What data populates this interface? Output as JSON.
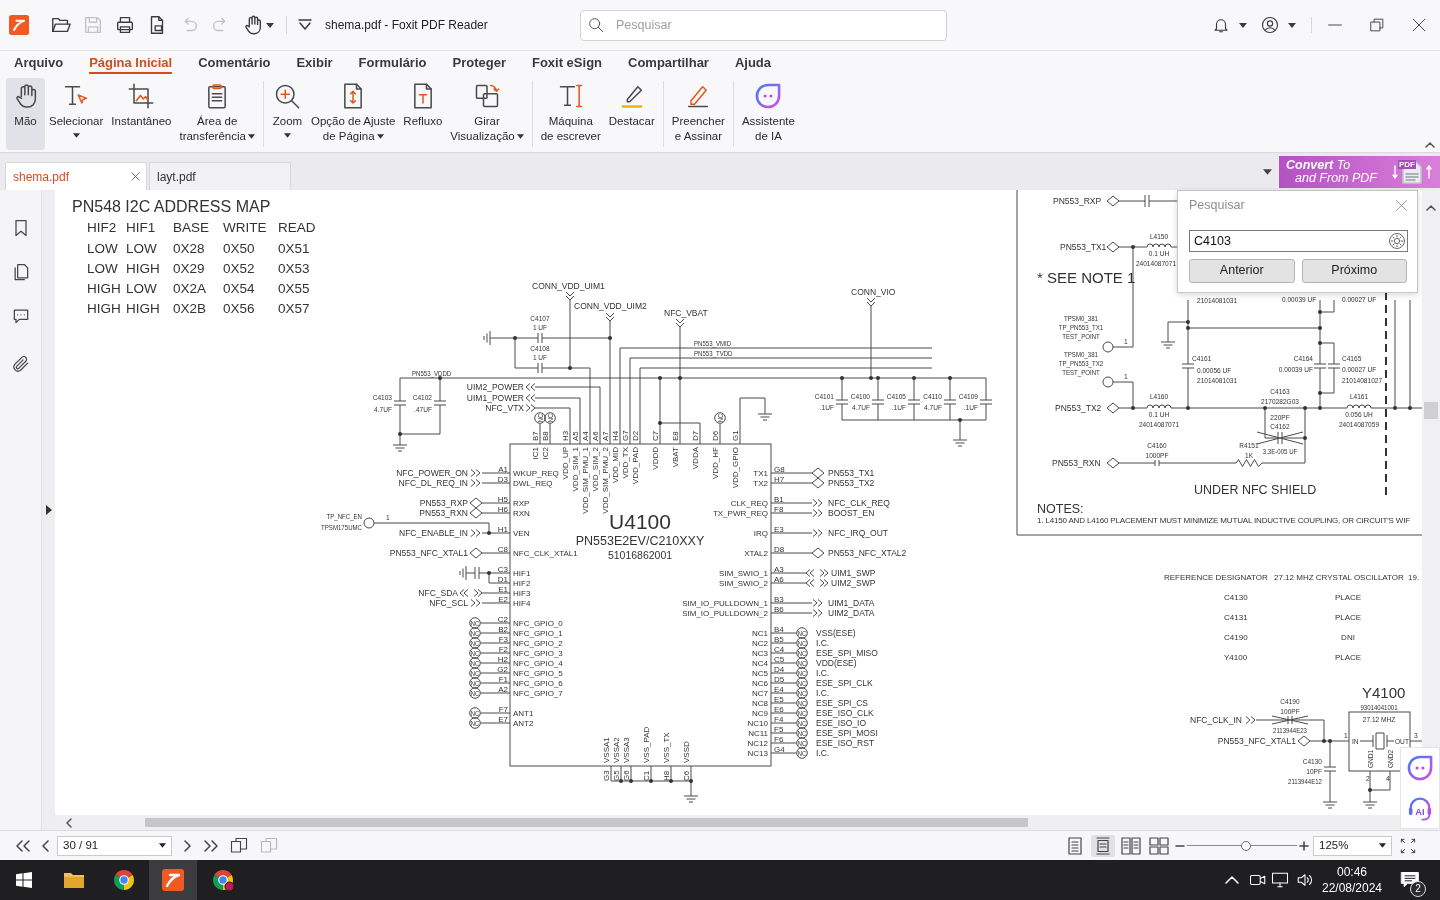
{
  "window": {
    "title": "shema.pdf - Foxit PDF Reader"
  },
  "quick_access": [
    {
      "disabled": false
    },
    {
      "disabled": true
    },
    {
      "disabled": false
    },
    {
      "disabled": false
    },
    {
      "disabled": true
    },
    {
      "disabled": true
    },
    {
      "disabled": false
    }
  ],
  "search": {
    "placeholder": "Pesquisar"
  },
  "menu": [
    {
      "label": "Arquivo",
      "selected": false
    },
    {
      "label": "Página Inicial",
      "selected": true
    },
    {
      "label": "Comentário",
      "selected": false
    },
    {
      "label": "Exibir",
      "selected": false
    },
    {
      "label": "Formulário",
      "selected": false
    },
    {
      "label": "Proteger",
      "selected": false
    },
    {
      "label": "Foxit eSign",
      "selected": false
    },
    {
      "label": "Compartilhar",
      "selected": false
    },
    {
      "label": "Ajuda",
      "selected": false
    }
  ],
  "ribbon": [
    [
      {
        "label": "Mão",
        "selected": true,
        "dropdown": false
      },
      {
        "label": "Selecionar",
        "selected": false,
        "dropdown": true
      },
      {
        "label": "Instantâneo",
        "selected": false,
        "dropdown": false
      },
      {
        "label": "Área de\ntransferência",
        "selected": false,
        "dropdown": true
      }
    ],
    [
      {
        "label": "Zoom",
        "selected": false,
        "dropdown": true
      },
      {
        "label": "Opção de Ajuste\nde Página",
        "selected": false,
        "dropdown": true
      },
      {
        "label": "Refluxo",
        "selected": false,
        "dropdown": false
      },
      {
        "label": "Girar\nVisualização",
        "selected": false,
        "dropdown": true
      }
    ],
    [
      {
        "label": "Máquina\nde escrever",
        "selected": false,
        "dropdown": false
      },
      {
        "label": "Destacar",
        "selected": false,
        "dropdown": false
      }
    ],
    [
      {
        "label": "Preencher\ne Assinar",
        "selected": false,
        "dropdown": false
      }
    ],
    [
      {
        "label": "Assistente\nde IA",
        "selected": false,
        "dropdown": false
      }
    ]
  ],
  "doc_tabs": [
    {
      "label": "shema.pdf",
      "selected": true
    },
    {
      "label": "layt.pdf",
      "selected": false
    }
  ],
  "banner": {
    "lines": [
      "**Convert** To",
      "and From PDF"
    ],
    "file_type": "PDF"
  },
  "find_panel": {
    "title": "Pesquisar",
    "query": "C4103",
    "buttons": [
      "Anterior",
      "Próximo"
    ]
  },
  "schematic": {
    "address_map": {
      "title": "PN548 I2C ADDRESS MAP",
      "columns": [
        "HIF2",
        "HIF1",
        "BASE",
        "WRITE",
        "READ"
      ],
      "rows": [
        [
          "LOW",
          "LOW",
          "0X28",
          "0X50",
          "0X51"
        ],
        [
          "LOW",
          "HIGH",
          "0X29",
          "0X52",
          "0X53"
        ],
        [
          "HIGH",
          "LOW",
          "0X2A",
          "0X54",
          "0X55"
        ],
        [
          "HIGH",
          "HIGH",
          "0X2B",
          "0X56",
          "0X57"
        ]
      ]
    },
    "top_labels": [
      {
        "text": "CONN_VDD_UIM1",
        "kind": "net"
      },
      {
        "text": "CONN_VIO",
        "kind": "net"
      },
      {
        "text": "CONN_VDD_UIM2",
        "kind": "net"
      },
      {
        "text": "C4107",
        "kind": "part"
      },
      {
        "text": "NFC_VBAT",
        "kind": "net"
      },
      {
        "text": "1 UF",
        "kind": "part"
      },
      {
        "text": "C4108",
        "kind": "part"
      },
      {
        "text": "PN553_VMID",
        "kind": "code"
      },
      {
        "text": "1 UF",
        "kind": "part"
      },
      {
        "text": "PN553_TVDD",
        "kind": "code"
      },
      {
        "text": "PN553_VDDD",
        "kind": "code"
      },
      {
        "text": "UIM2_POWER",
        "kind": "net"
      },
      {
        "text": "C4103",
        "kind": "part"
      },
      {
        "text": "C4102",
        "kind": "part"
      },
      {
        "text": "UIM1_POWER",
        "kind": "net"
      },
      {
        "text": "C4101",
        "kind": "part"
      },
      {
        "text": "C4100",
        "kind": "part"
      },
      {
        "text": "C4105",
        "kind": "part"
      },
      {
        "text": "C4110",
        "kind": "part"
      },
      {
        "text": "C4109",
        "kind": "part"
      },
      {
        "text": "4.7UF",
        "kind": "part"
      },
      {
        "text": ".47UF",
        "kind": "part"
      },
      {
        "text": "NFC_VTX",
        "kind": "net"
      },
      {
        "text": ".1UF",
        "kind": "part"
      },
      {
        "text": "4.7UF",
        "kind": "part"
      },
      {
        "text": ".1UF",
        "kind": "part"
      },
      {
        "text": "4.7UF",
        "kind": "part"
      },
      {
        "text": ".1UF",
        "kind": "part"
      }
    ],
    "chip": {
      "top": [
        [
          {
            "pin": "B7",
            "name": "IC1",
            "kind": "nc",
            "mark": "NC"
          },
          {
            "pin": "B8",
            "name": "IC2",
            "kind": "nc",
            "mark": "NC"
          }
        ],
        [
          {
            "pin": "H3",
            "name": "VDD_UP",
            "kind": "none"
          },
          {
            "pin": "A5",
            "name": "VDD_SIM_1",
            "kind": "none"
          },
          {
            "pin": "A4",
            "name": "VDD_SIM_PMU_1",
            "kind": "none"
          },
          {
            "pin": "A6",
            "name": "VDD_SIM_2",
            "kind": "none"
          },
          {
            "pin": "A7",
            "name": "VDD_SIM_PMU_2",
            "kind": "none"
          },
          {
            "pin": "H4",
            "name": "VDD_MID",
            "kind": "none"
          },
          {
            "pin": "G7",
            "name": "VDD_TX",
            "kind": "none"
          },
          {
            "pin": "D2",
            "name": "VDD_PAD",
            "kind": "none"
          }
        ],
        [
          {
            "pin": "C7",
            "name": "VDDD",
            "kind": "none"
          }
        ],
        [
          {
            "pin": "E8",
            "name": "VBAT",
            "kind": "none"
          }
        ],
        [
          {
            "pin": "D7",
            "name": "VDDA",
            "kind": "none"
          }
        ],
        [
          {
            "pin": "D6",
            "name": "VDD_HF",
            "kind": "nc",
            "mark": "NC"
          }
        ],
        [
          {
            "pin": "G1",
            "name": "VDD_GPIO",
            "kind": "none"
          }
        ]
      ],
      "ref": "U4100",
      "part": "PN553E2EV/C210XXY",
      "code": "51016862001",
      "left": [
        [
          {
            "pin": "A1",
            "name": "WKUP_REQ",
            "kind": "in",
            "net": "NFC_POWER_ON"
          },
          {
            "pin": "D3",
            "name": "DWL_REQ",
            "kind": "in",
            "net": "NFC_DL_REQ_IN"
          }
        ],
        [
          {
            "pin": "H5",
            "name": "RXP",
            "kind": "port",
            "net": "PN553_RXP"
          },
          {
            "pin": "H6",
            "name": "RXN",
            "kind": "port",
            "net": "PN553_RXN"
          }
        ],
        [
          {
            "pin": "H1",
            "name": "VEN",
            "kind": "in",
            "net": "NFC_ENABLE_IN"
          }
        ],
        [
          {
            "pin": "C8",
            "name": "NFC_CLK_XTAL1",
            "kind": "port",
            "net": "PN553_NFC_XTAL1"
          }
        ],
        [
          {
            "pin": "C3",
            "name": "HIF1",
            "kind": "none"
          },
          {
            "pin": "D1",
            "name": "HIF2",
            "kind": "none"
          },
          {
            "pin": "E1",
            "name": "HIF3",
            "kind": "bidir",
            "net": "NFC_SDA"
          },
          {
            "pin": "E2",
            "name": "HIF4",
            "kind": "in",
            "net": "NFC_SCL"
          }
        ],
        [
          {
            "pin": "C2",
            "name": "NFC_GPIO_0",
            "kind": "nc",
            "mark": "NC"
          },
          {
            "pin": "B2",
            "name": "NFC_GPIO_1",
            "kind": "nc",
            "mark": "NC"
          },
          {
            "pin": "F3",
            "name": "NFC_GPIO_2",
            "kind": "nc",
            "mark": "NC"
          },
          {
            "pin": "F2",
            "name": "NFC_GPIO_3",
            "kind": "nc",
            "mark": "NC"
          },
          {
            "pin": "H2",
            "name": "NFC_GPIO_4",
            "kind": "nc",
            "mark": "NC"
          },
          {
            "pin": "G2",
            "name": "NFC_GPIO_5",
            "kind": "nc",
            "mark": "NC"
          },
          {
            "pin": "F1",
            "name": "NFC_GPIO_6",
            "kind": "nc",
            "mark": "NC"
          },
          {
            "pin": "A2",
            "name": "NFC_GPIO_7",
            "kind": "nc",
            "mark": "NC"
          }
        ],
        [
          {
            "pin": "F7",
            "name": "ANT1",
            "kind": "nc",
            "mark": "NC"
          },
          {
            "pin": "E7",
            "name": "ANT2",
            "kind": "nc",
            "mark": "NC"
          }
        ]
      ],
      "right": [
        [
          {
            "pin": "G8",
            "name": "TX1",
            "kind": "port",
            "net": "PN553_TX1"
          },
          {
            "pin": "H7",
            "name": "TX2",
            "kind": "port",
            "net": "PN553_TX2"
          }
        ],
        [
          {
            "pin": "B1",
            "name": "CLK_REQ",
            "kind": "out",
            "net": "NFC_CLK_REQ"
          },
          {
            "pin": "F8",
            "name": "TX_PWR_REQ",
            "kind": "out",
            "net": "BOOST_EN"
          }
        ],
        [
          {
            "pin": "E3",
            "name": "IRQ",
            "kind": "out",
            "net": "NFC_IRQ_OUT"
          }
        ],
        [
          {
            "pin": "D8",
            "name": "XTAL2",
            "kind": "port",
            "net": "PN553_NFC_XTAL2"
          }
        ],
        [
          {
            "pin": "A3",
            "name": "SIM_SWIO_1",
            "kind": "bidir",
            "net": "UIM1_SWP"
          },
          {
            "pin": "A6",
            "name": "SIM_SWIO_2",
            "kind": "bidir",
            "net": "UIM2_SWP"
          }
        ],
        [
          {
            "pin": "B3",
            "name": "SIM_IO_PULLDOWN_1",
            "kind": "out",
            "net": "UIM1_DATA"
          },
          {
            "pin": "B6",
            "name": "SIM_IO_PULLDOWN_2",
            "kind": "out",
            "net": "UIM2_DATA"
          }
        ],
        [
          {
            "pin": "B4",
            "name": "NC1",
            "kind": "nc",
            "mark": "NC",
            "net": "VSS(ESE)"
          },
          {
            "pin": "B5",
            "name": "NC2",
            "kind": "nc",
            "mark": "NC",
            "net": "I.C."
          },
          {
            "pin": "C4",
            "name": "NC3",
            "kind": "nc",
            "mark": "NC",
            "net": "ESE_SPI_MISO"
          },
          {
            "pin": "C5",
            "name": "NC4",
            "kind": "nc",
            "mark": "NC",
            "net": "VDD(ESE)"
          },
          {
            "pin": "D4",
            "name": "NC5",
            "kind": "nc",
            "mark": "NC",
            "net": "I.C."
          },
          {
            "pin": "D5",
            "name": "NC6",
            "kind": "nc",
            "mark": "NC",
            "net": "ESE_SPI_CLK"
          },
          {
            "pin": "E4",
            "name": "NC7",
            "kind": "nc",
            "mark": "NC",
            "net": "I.C."
          },
          {
            "pin": "E5",
            "name": "NC8",
            "kind": "nc",
            "mark": "NC",
            "net": "ESE_SPI_CS"
          },
          {
            "pin": "E6",
            "name": "NC9",
            "kind": "nc",
            "mark": "NC",
            "net": "ESE_ISO_CLK"
          },
          {
            "pin": "F4",
            "name": "NC10",
            "kind": "nc",
            "mark": "NC",
            "net": "ESE_ISO_IO"
          },
          {
            "pin": "F5",
            "name": "NC11",
            "kind": "nc",
            "mark": "NC",
            "net": "ESE_SPI_MOSI"
          },
          {
            "pin": "F6",
            "name": "NC12",
            "kind": "nc",
            "mark": "NC",
            "net": "ESE_ISO_RST"
          },
          {
            "pin": "G4",
            "name": "NC13",
            "kind": "nc",
            "mark": "NC",
            "net": "I.C."
          }
        ]
      ],
      "bottom": [
        [
          {
            "pin": "G3",
            "name": "VSSA1"
          },
          {
            "pin": "G5",
            "name": "VSSA2"
          },
          {
            "pin": "G6",
            "name": "VSSA3"
          }
        ],
        [
          {
            "pin": "C1",
            "name": "VSS_PAD"
          }
        ],
        [
          {
            "pin": "H8",
            "name": "VSS_TX"
          }
        ],
        [
          {
            "pin": "C6",
            "name": "VSSD"
          }
        ]
      ]
    },
    "test_point_labels": [
      {
        "text": "TP_NFC_EN",
        "kind": "code"
      },
      {
        "text": "1",
        "kind": "part"
      },
      {
        "text": "TPSM175UMC",
        "kind": "code"
      }
    ],
    "rf_ports": [
      {
        "text": "PN553_RXP",
        "kind": "net"
      },
      {
        "text": "PN553_TX1",
        "kind": "net"
      },
      {
        "text": "PN553_TX2",
        "kind": "net"
      },
      {
        "text": "PN553_RXN",
        "kind": "net"
      }
    ],
    "rf_test_points": [
      {
        "text": "TPSM0_381",
        "kind": "code"
      },
      {
        "text": "TP_PN553_TX1",
        "kind": "code"
      },
      {
        "text": "TEST_POINT",
        "kind": "code"
      },
      {
        "text": "1",
        "kind": "part"
      },
      {
        "text": "TPSM0_381",
        "kind": "code"
      },
      {
        "text": "TP_PN553_TX2",
        "kind": "code"
      },
      {
        "text": "TEST_POINT",
        "kind": "code"
      },
      {
        "text": "1",
        "kind": "part"
      }
    ],
    "rf_components": [
      {
        "text": "L4150",
        "kind": "part"
      },
      {
        "text": "0.1 UH",
        "kind": "part"
      },
      {
        "text": "24014087071",
        "kind": "part"
      },
      {
        "text": "21014081031",
        "kind": "part"
      },
      {
        "text": "0.00039 UF",
        "kind": "part"
      },
      {
        "text": "0.00027 UF",
        "kind": "part"
      },
      {
        "text": "C4161",
        "kind": "part"
      },
      {
        "text": "C4164",
        "kind": "part"
      },
      {
        "text": "C4165",
        "kind": "part"
      },
      {
        "text": "0.00056 UF",
        "kind": "part"
      },
      {
        "text": "0.00039 UF",
        "kind": "part"
      },
      {
        "text": "0.00027 UF",
        "kind": "part"
      },
      {
        "text": "21014081031",
        "kind": "part"
      },
      {
        "text": "21014081027",
        "kind": "part"
      },
      {
        "text": "L4160",
        "kind": "part"
      },
      {
        "text": "C4163",
        "kind": "part"
      },
      {
        "text": "2170282G03",
        "kind": "part"
      },
      {
        "text": "L4161",
        "kind": "part"
      },
      {
        "text": "0.1 UH",
        "kind": "part"
      },
      {
        "text": "220PF",
        "kind": "part"
      },
      {
        "text": "0.056 UH",
        "kind": "part"
      },
      {
        "text": "24014087071",
        "kind": "part"
      },
      {
        "text": "C4162",
        "kind": "part"
      },
      {
        "text": "24014087059",
        "kind": "part"
      },
      {
        "text": "C4160",
        "kind": "part"
      },
      {
        "text": "1000PF",
        "kind": "part"
      },
      {
        "text": "R4151",
        "kind": "part"
      },
      {
        "text": "1K",
        "kind": "part"
      },
      {
        "text": "3.3E-005 UF",
        "kind": "code"
      }
    ],
    "rf_notes": [
      {
        "text": "* SEE NOTE 1",
        "kind": "title"
      },
      {
        "text": "UNDER NFC SHIELD",
        "kind": "heading"
      },
      {
        "text": "NOTES:",
        "kind": "heading"
      },
      {
        "text": "1. L4150 AND L4160 PLACEMENT MUST MINIMIZE MUTUAL INDUCTIVE COUPLING, OR CIRCUIT'S WIF",
        "kind": "note"
      }
    ],
    "reference_table": {
      "columns": [
        "REFERENCE DESIGNATOR",
        "27.12 MHZ CRYSTAL OSCILLATOR",
        "19."
      ],
      "rows": [
        [
          "C4130",
          "PLACE"
        ],
        [
          "C4131",
          "PLACE"
        ],
        [
          "C4190",
          "DNI"
        ],
        [
          "Y4100",
          "PLACE"
        ]
      ]
    },
    "crystal_labels": [
      {
        "text": "C4190",
        "kind": "part"
      },
      {
        "text": "Y4100",
        "kind": "title"
      },
      {
        "text": "100PF",
        "kind": "part"
      },
      {
        "text": "93014041001",
        "kind": "code"
      },
      {
        "text": "NFC_CLK_IN",
        "kind": "net"
      },
      {
        "text": "27.12 MHZ",
        "kind": "part"
      },
      {
        "text": "2113944E23",
        "kind": "code"
      },
      {
        "text": "PN553_NFC_XTAL1",
        "kind": "net"
      },
      {
        "text": "1",
        "kind": "part"
      },
      {
        "text": "IN",
        "kind": "part"
      },
      {
        "text": "OUT",
        "kind": "part"
      },
      {
        "text": "3",
        "kind": "part"
      },
      {
        "text": "C4130",
        "kind": "part"
      },
      {
        "text": "10PF",
        "kind": "part"
      },
      {
        "text": "GND1",
        "kind": "part"
      },
      {
        "text": "GND2",
        "kind": "part"
      },
      {
        "text": "2113944E12",
        "kind": "code"
      },
      {
        "text": "2",
        "kind": "part"
      },
      {
        "text": "4",
        "kind": "part"
      }
    ]
  },
  "assistant": {
    "support_label": "AI"
  },
  "status_bar": {
    "page": "30 / 91",
    "page_tools": [
      {
        "disabled": false
      },
      {
        "disabled": true
      }
    ],
    "view_modes": [
      {
        "selected": false
      },
      {
        "selected": true
      },
      {
        "selected": false
      },
      {
        "selected": false
      }
    ],
    "zoom": {
      "level": 0.54,
      "value": "125%"
    }
  },
  "taskbar": {
    "apps": [
      {
        "active": false
      },
      {
        "active": false
      },
      {
        "active": true
      },
      {
        "active": false
      }
    ],
    "time": "00:46",
    "date": "22/08/2024",
    "notifications": "2"
  }
}
